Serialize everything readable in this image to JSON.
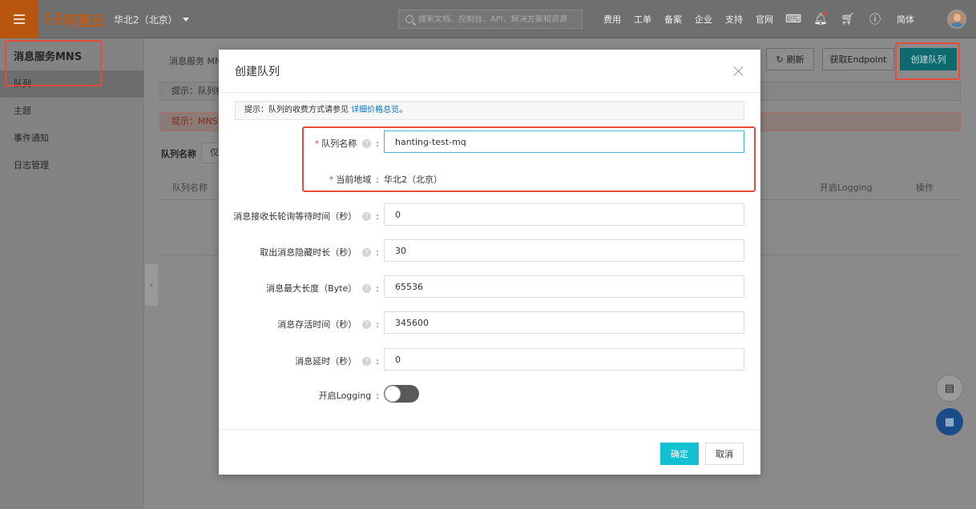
{
  "topbar": {
    "logo_text": "阿里云",
    "region": "华北2（北京）",
    "search_placeholder": "搜索文档、控制台、API、解决方案和资源",
    "nav_links": [
      "费用",
      "工单",
      "备案",
      "企业",
      "支持",
      "官网"
    ],
    "lang": "简体"
  },
  "sidebar": {
    "title": "消息服务MNS",
    "items": [
      {
        "label": "队列",
        "active": true
      },
      {
        "label": "主题",
        "active": false
      },
      {
        "label": "事件通知",
        "active": false
      },
      {
        "label": "日志管理",
        "active": false
      }
    ]
  },
  "background": {
    "breadcrumb": "消息服务 MN",
    "refresh_label": "刷新",
    "endpoint_label": "获取Endpoint",
    "create_queue_label": "创建队列",
    "tip1": "提示：队列模",
    "tip2": "提示：MNS计",
    "filter_label": "队列名称",
    "filter_value": "仅",
    "col_queue_name": "队列名称",
    "col_logging": "开启Logging",
    "col_action": "操作"
  },
  "modal": {
    "title": "创建队列",
    "tip_prefix": "提示：队列的收费方式请参见",
    "tip_link": "详细价格总览",
    "tip_suffix": "。",
    "fields": {
      "queue_name": {
        "label": "队列名称",
        "value": "hanting-test-mq"
      },
      "region": {
        "label": "当前地域",
        "value": "华北2（北京）"
      },
      "polling_wait": {
        "label": "消息接收长轮询等待时间（秒）",
        "value": "0"
      },
      "visibility_timeout": {
        "label": "取出消息隐藏时长（秒）",
        "value": "30"
      },
      "max_length": {
        "label": "消息最大长度（Byte）",
        "value": "65536"
      },
      "retention": {
        "label": "消息存活时间（秒）",
        "value": "345600"
      },
      "delay": {
        "label": "消息延时（秒）",
        "value": "0"
      },
      "logging": {
        "label": "开启Logging",
        "enabled": false
      }
    },
    "ok_label": "确定",
    "cancel_label": "取消"
  },
  "colors": {
    "accent": "#11c1d2",
    "annotation": "#e64b3b",
    "link": "#0070cc"
  }
}
